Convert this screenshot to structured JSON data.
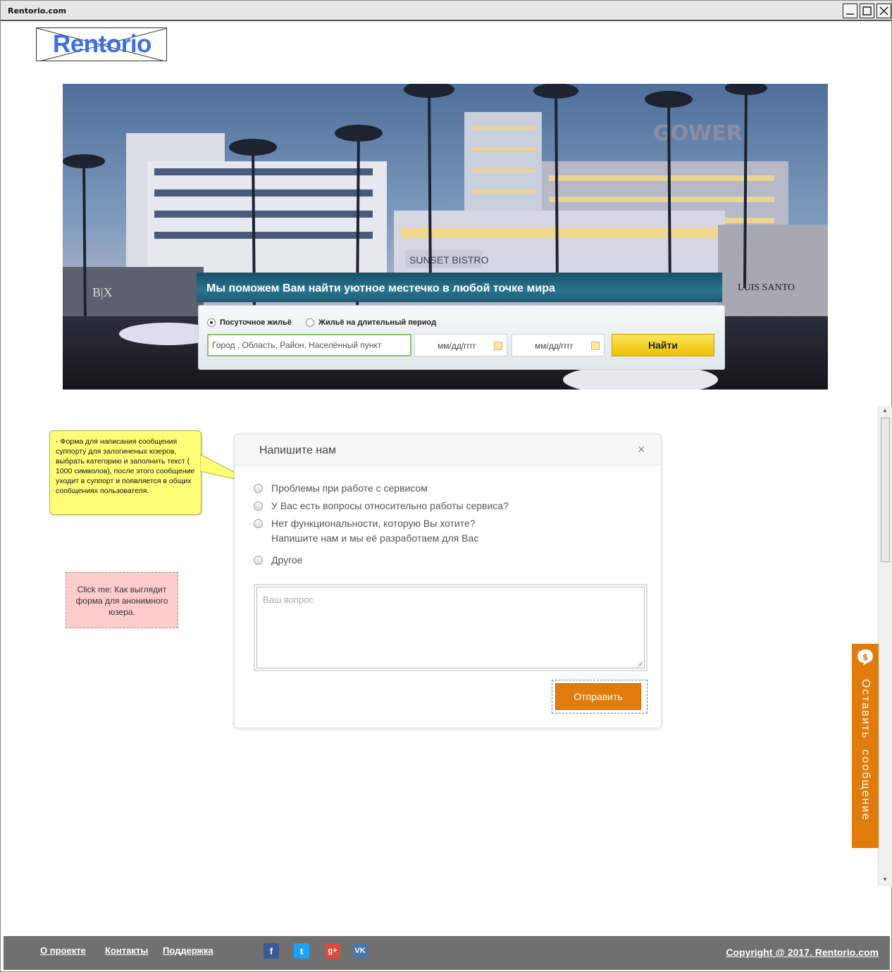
{
  "window": {
    "title": "Rentorio.com"
  },
  "logo": {
    "text": "Rentorio"
  },
  "search": {
    "heading": "Мы поможем Вам найти уютное местечко в любой точке мира",
    "radio_daily": "Посуточное жильё",
    "radio_long": "Жильё на длительный период",
    "city_value": "Город  , Область, Район, Населённый пункт",
    "date_from": "мм/дд/гггг",
    "date_to": "мм/дд/гггг",
    "find_label": "Найти"
  },
  "annotations": {
    "yellow_note": "- Форма для написания сообщения суппорту для залогиненых юзеров, выбрать категорию и заполнить текст ( 1000 символов), после этого сообщение уходит в суппорт и появляется в общих сообщениях пользователя.",
    "pink_note": "Click me: Как выглядит форма для анонимного юзера."
  },
  "modal": {
    "title": "Напишите нам",
    "close": "×",
    "options": [
      {
        "line1": "Проблемы при работе с сервисом",
        "line2": ""
      },
      {
        "line1": "У Вас есть вопросы относительно работы сервиса?",
        "line2": ""
      },
      {
        "line1": "Нет функциональности, которую Вы хотите?",
        "line2": "Напишите нам и мы её разработаем для Вас"
      },
      {
        "line1": "Другое",
        "line2": ""
      }
    ],
    "textarea_placeholder": "Ваш вопрос",
    "submit_label": "Отправить"
  },
  "sidetab": {
    "label": "Оставить сообщение"
  },
  "footer": {
    "links": [
      "О проекте",
      "Контакты",
      "Поддержка"
    ],
    "social": [
      "f",
      "t",
      "g+",
      "VK"
    ],
    "copyright": "Copyright @ 2017. Rentorio.com"
  },
  "colors": {
    "accent": "#e07b0c",
    "logo": "#3b6fe0",
    "footer": "#707070",
    "note": "#ffff77"
  }
}
